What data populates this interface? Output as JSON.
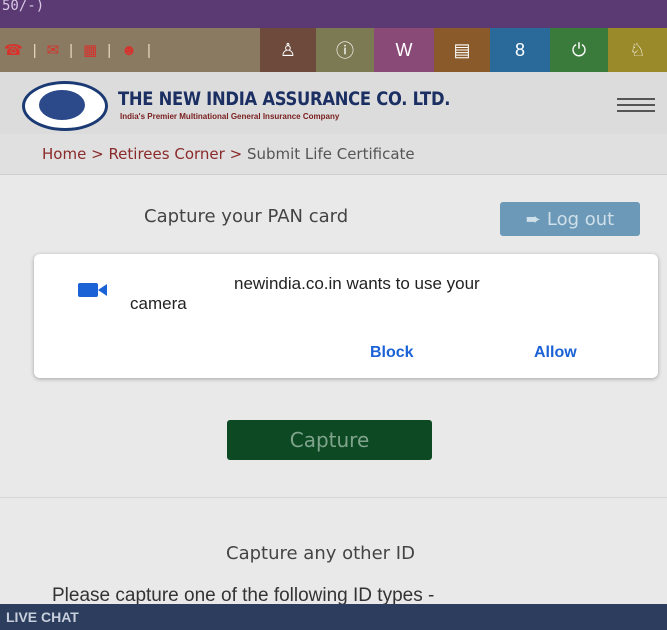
{
  "status": {
    "fragment": "50/-)"
  },
  "contact_icons": [
    "phone-icon",
    "mail-icon",
    "fax-icon",
    "user-icon"
  ],
  "nav_icons": [
    {
      "name": "group-icon",
      "glyph": "☗",
      "color": "#6e4a3c"
    },
    {
      "name": "info-icon",
      "glyph": "ℹ",
      "color": "#7c7a52"
    },
    {
      "name": "word-doc-icon",
      "glyph": "W",
      "color": "#8a4a78"
    },
    {
      "name": "document-icon",
      "glyph": "▤",
      "color": "#8a5a2a"
    },
    {
      "name": "link-icon",
      "glyph": "8",
      "color": "#2a6a9a"
    },
    {
      "name": "lock-icon",
      "glyph": "⌂",
      "color": "#3a7a3a"
    },
    {
      "name": "users-icon",
      "glyph": "☗",
      "color": "#9a8a2a"
    }
  ],
  "header": {
    "company": "THE NEW INDIA ASSURANCE CO. LTD.",
    "tagline": "India's Premier Multinational General Insurance Company"
  },
  "breadcrumb": {
    "home": "Home",
    "sep": ">",
    "section": "Retirees Corner",
    "current": "Submit Life Certificate"
  },
  "main": {
    "pan_label": "Capture your PAN card",
    "logout_label": "Log out",
    "capture_label": "Capture",
    "other_id_label": "Capture any other ID",
    "please_capture": "Please capture one of the following ID types -"
  },
  "dialog": {
    "line1": "newindia.co.in wants to use your",
    "line2": "camera",
    "block": "Block",
    "allow": "Allow",
    "accent": "#1a62d6"
  },
  "footer": {
    "live_chat": "LIVE CHAT"
  }
}
